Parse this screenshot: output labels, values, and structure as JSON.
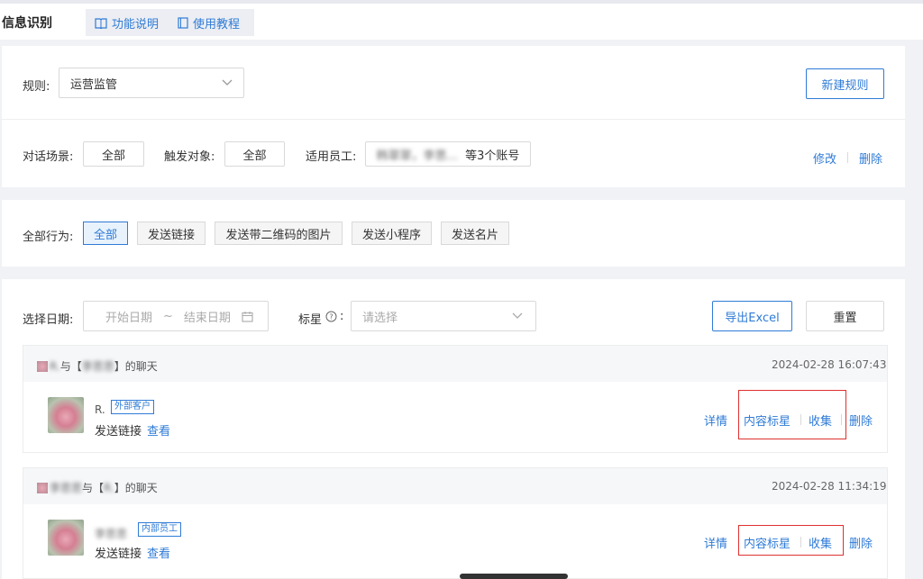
{
  "header": {
    "title": "信息识别",
    "tabs": [
      {
        "label": "功能说明",
        "icon": "book-icon"
      },
      {
        "label": "使用教程",
        "icon": "document-icon"
      }
    ]
  },
  "rule_panel": {
    "rule_label": "规则:",
    "rule_value": "运营监管",
    "new_rule_button": "新建规则",
    "scene_label": "对话场景:",
    "scene_value": "全部",
    "trigger_label": "触发对象:",
    "trigger_value": "全部",
    "staff_label": "适用员工:",
    "staff_names": "韩翠翠，李思...",
    "staff_count": "等3个账号",
    "edit_link": "修改",
    "delete_link": "删除"
  },
  "behavior_panel": {
    "label": "全部行为:",
    "chips": [
      "全部",
      "发送链接",
      "发送带二维码的图片",
      "发送小程序",
      "发送名片"
    ],
    "active_index": 0
  },
  "filter_panel": {
    "date_label": "选择日期:",
    "start_placeholder": "开始日期",
    "tilde": "~",
    "end_placeholder": "结束日期",
    "star_label": "标星",
    "star_colon": ":",
    "star_placeholder": "请选择",
    "export_button": "导出Excel",
    "reset_button": "重置"
  },
  "records": [
    {
      "header_prefix": "R.",
      "header_mid": "与【",
      "header_name": "李思思",
      "header_suffix": "】的聊天",
      "timestamp": "2024-02-28 16:07:43",
      "user_name": "R.",
      "badge": "外部客户",
      "action_text": "发送链接",
      "view_link": "查看",
      "actions": [
        "详情",
        "内容标星",
        "收集",
        "删除"
      ]
    },
    {
      "header_prefix": "李思思",
      "header_mid": "与【",
      "header_name": "R.",
      "header_suffix": "】的聊天",
      "timestamp": "2024-02-28 11:34:19",
      "user_name": "李思思",
      "badge": "内部员工",
      "action_text": "发送链接",
      "view_link": "查看",
      "actions": [
        "详情",
        "内容标星",
        "收集",
        "删除"
      ]
    }
  ],
  "colors": {
    "accent": "#2f7bd6",
    "highlight": "#e03030",
    "background": "#f0f2f5"
  }
}
